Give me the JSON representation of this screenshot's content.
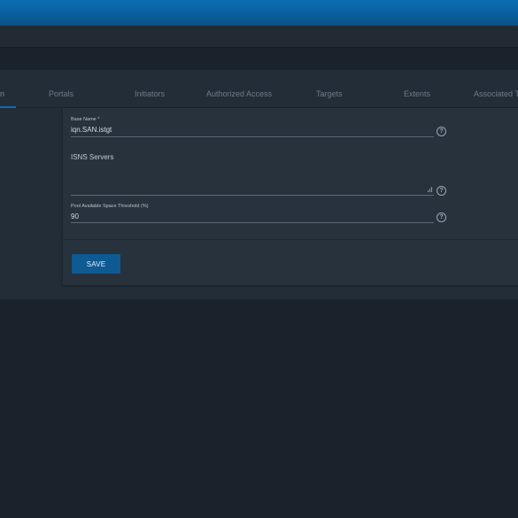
{
  "tabs": [
    {
      "label": "n"
    },
    {
      "label": "Portals"
    },
    {
      "label": "Initiators"
    },
    {
      "label": "Authorized Access"
    },
    {
      "label": "Targets"
    },
    {
      "label": "Extents"
    },
    {
      "label": "Associated T"
    }
  ],
  "form": {
    "base_name": {
      "label": "Base Name *",
      "value": "iqn.SAN.istgt"
    },
    "isns_servers": {
      "label": "ISNS Servers",
      "value": ""
    },
    "pool_threshold": {
      "label": "Pool Available Space Threshold (%)",
      "value": "90"
    },
    "save_label": "SAVE"
  },
  "icons": {
    "help": "help-circle-icon",
    "resize": "textarea-resize-icon"
  },
  "colors": {
    "accent": "#0d6db4",
    "button": "#0e5a93",
    "background": "#1a222b",
    "card": "#232d37"
  }
}
